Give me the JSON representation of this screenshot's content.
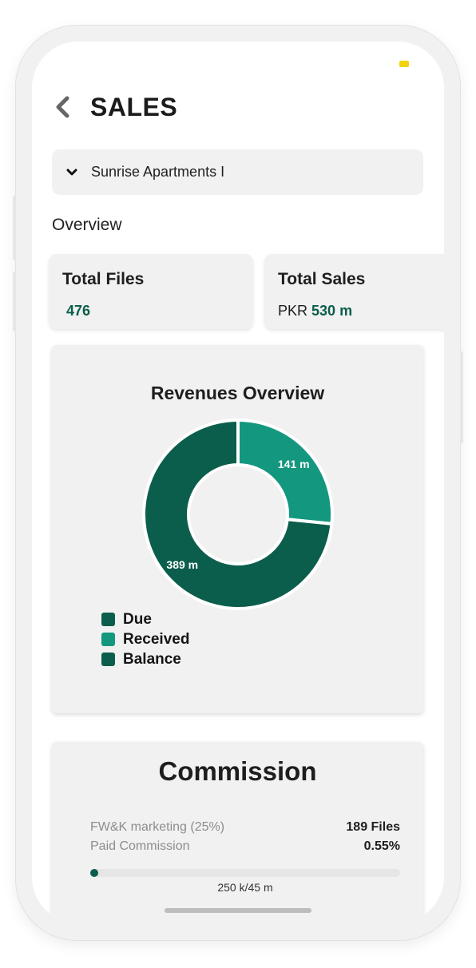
{
  "header": {
    "title": "SALES"
  },
  "project_selector": {
    "value": "Sunrise Apartments I"
  },
  "overview": {
    "label": "Overview",
    "cards": [
      {
        "title": "Total Files",
        "value": "476"
      },
      {
        "title": "Total Sales",
        "prefix": "PKR",
        "value": "530 m"
      }
    ]
  },
  "revenues": {
    "title": "Revenues Overview",
    "legend": [
      "Due",
      "Received",
      "Balance"
    ]
  },
  "chart_data": {
    "type": "pie",
    "title": "Revenues Overview",
    "donut": true,
    "slices": [
      {
        "label": "Received",
        "value": 141,
        "display": "141 m",
        "color": "#13977f"
      },
      {
        "label": "Balance",
        "value": 389,
        "display": "389 m",
        "color": "#0b5e4b"
      }
    ],
    "legend": [
      {
        "label": "Due",
        "color": "#0b5e4b"
      },
      {
        "label": "Received",
        "color": "#13977f"
      },
      {
        "label": "Balance",
        "color": "#0b5e4b"
      }
    ]
  },
  "commission": {
    "title": "Commission",
    "rows": [
      {
        "label": "FW&K marketing (25%)",
        "value": "189 Files"
      },
      {
        "label": "Paid Commission",
        "value": "0.55%"
      }
    ],
    "progress": {
      "fraction": 0.0055,
      "label": "250 k/45 m"
    }
  },
  "colors": {
    "accent": "#0b5e4b",
    "accent_light": "#13977f",
    "card_bg": "#f1f1f1",
    "status_dot": "#f2d20a"
  },
  "icons": {
    "back": "chevron-left-icon",
    "dropdown": "chevron-down-icon"
  }
}
